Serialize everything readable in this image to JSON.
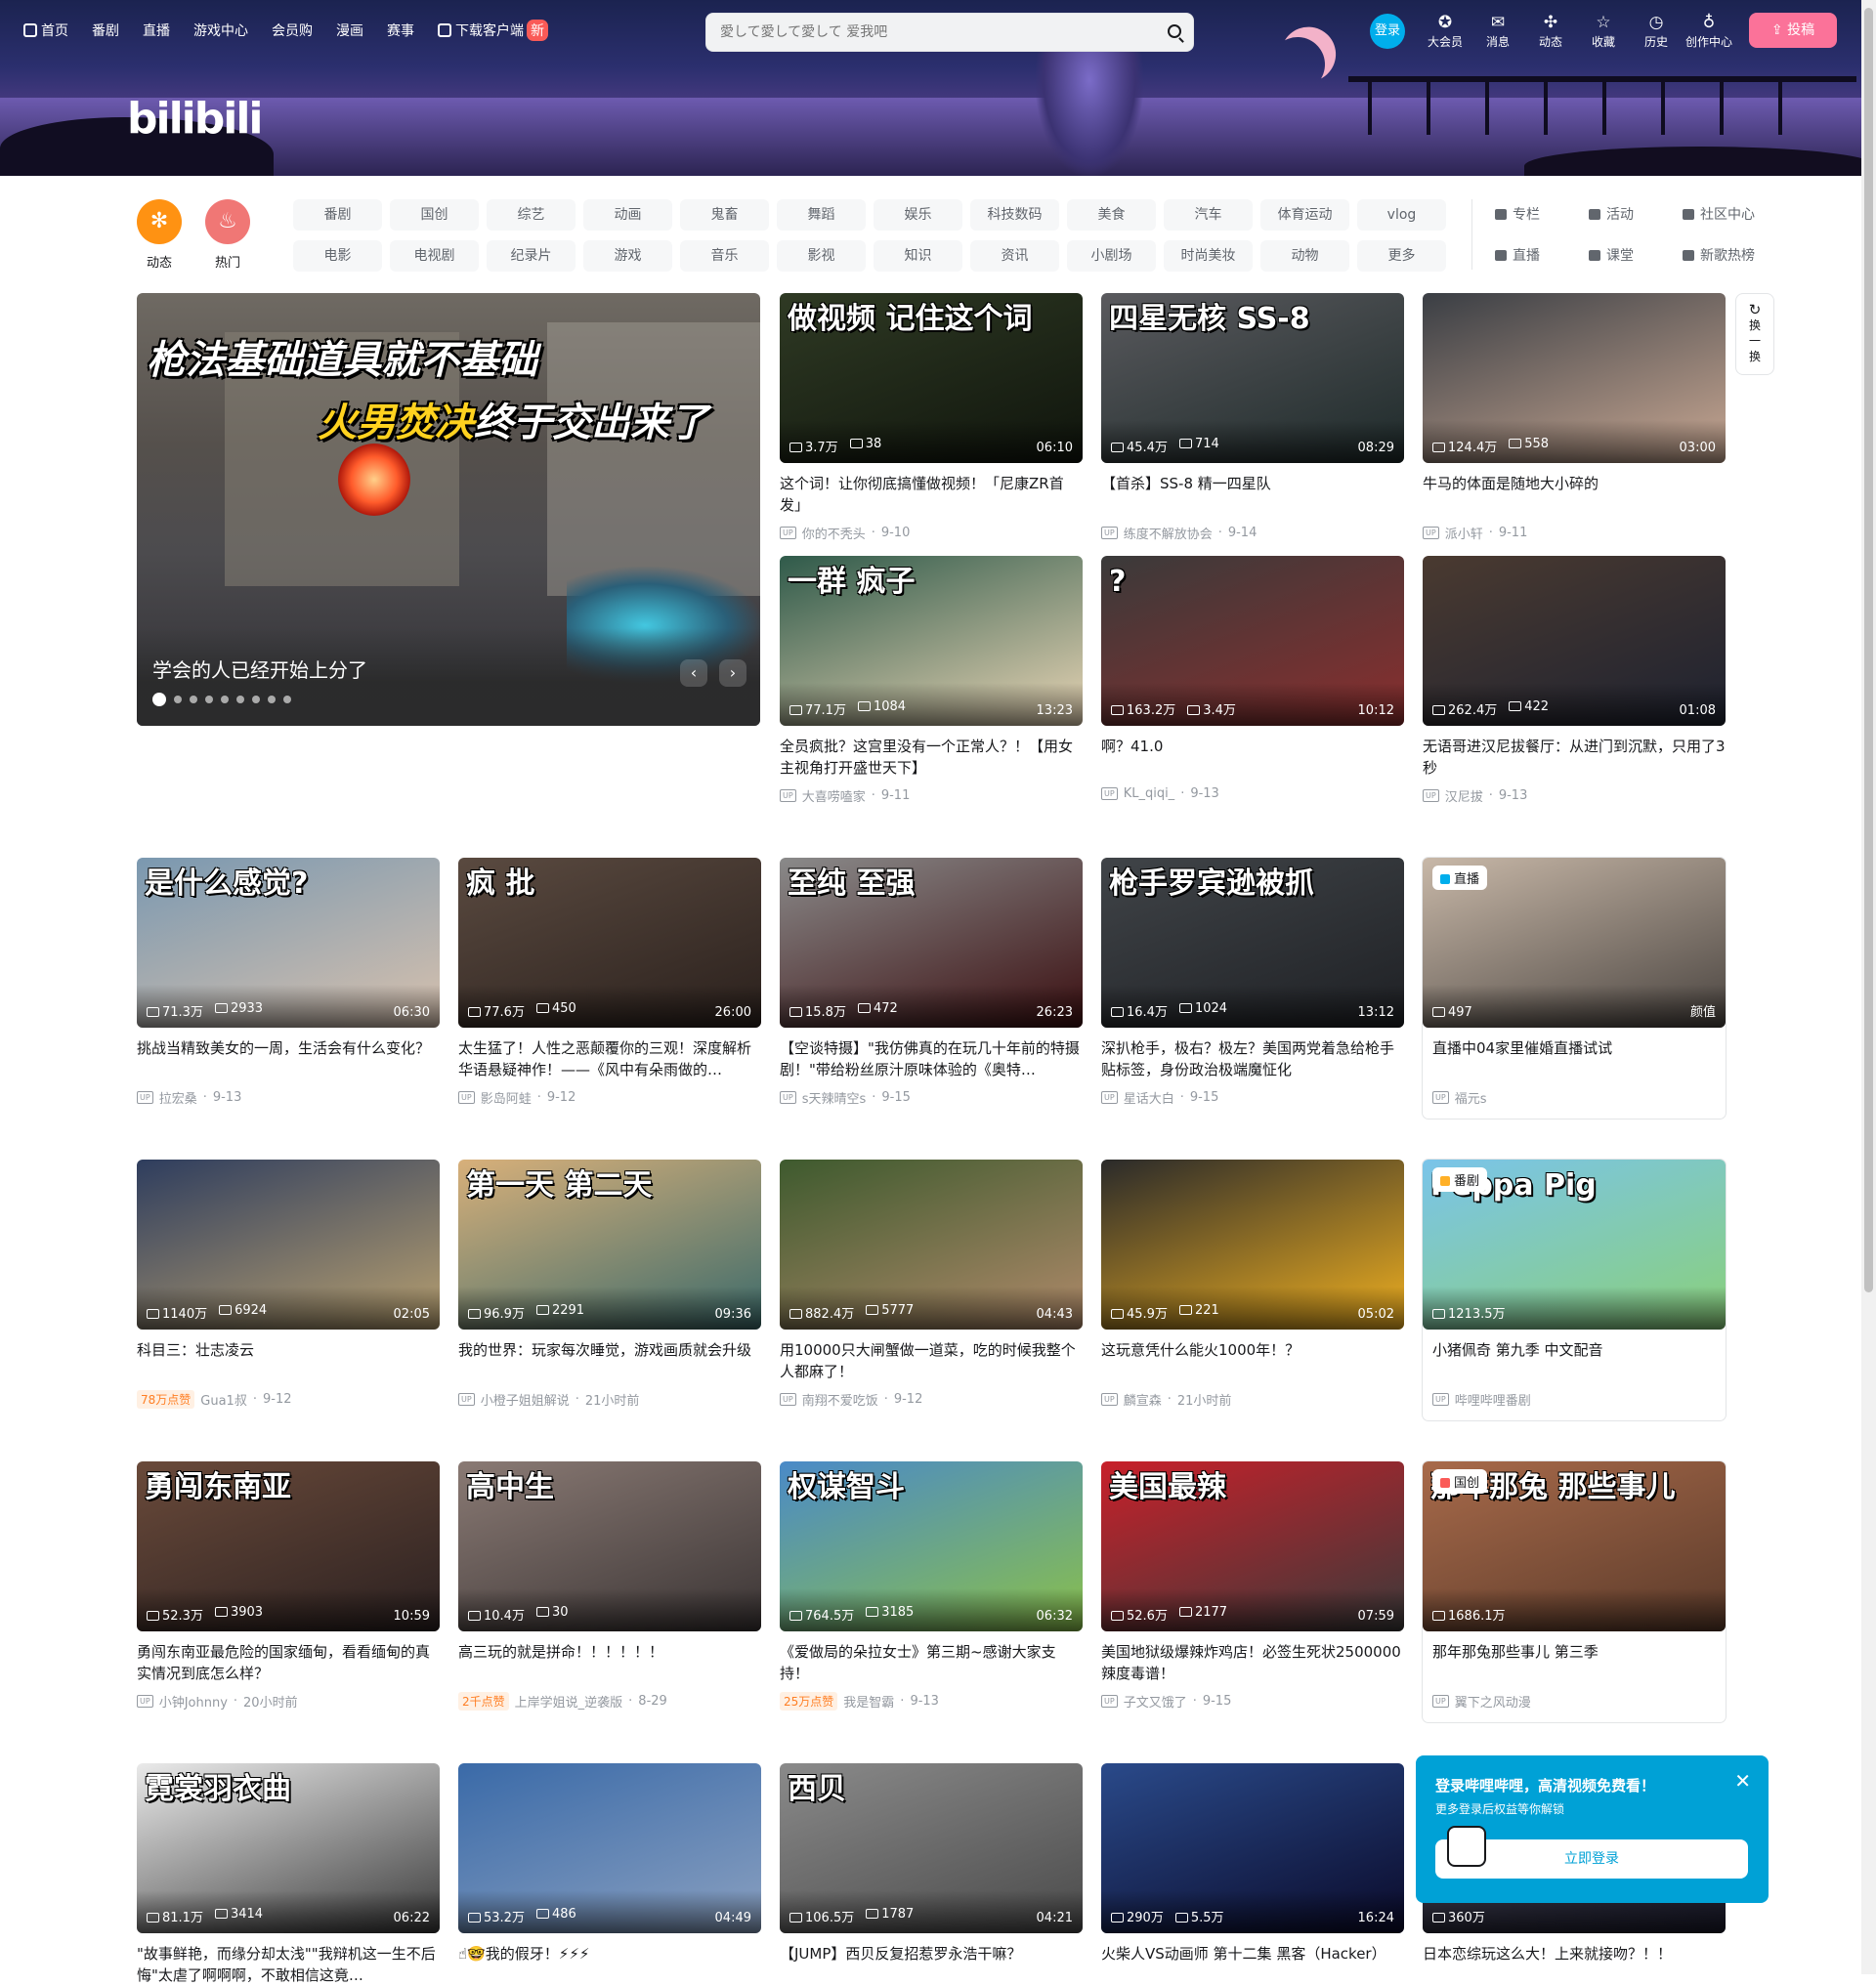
{
  "topnav": {
    "home": "首页",
    "bangumi": "番剧",
    "live": "直播",
    "game": "游戏中心",
    "mall": "会员购",
    "manga": "漫画",
    "match": "赛事",
    "download": "下载客户端",
    "new_badge": "新"
  },
  "search": {
    "placeholder": "愛して愛して愛して 爱我吧"
  },
  "header": {
    "login": "登录",
    "logo": "bilibili",
    "icons": [
      {
        "label": "大会员",
        "icon": "vip-icon"
      },
      {
        "label": "消息",
        "icon": "message-icon"
      },
      {
        "label": "动态",
        "icon": "dynamic-icon"
      },
      {
        "label": "收藏",
        "icon": "favorite-icon"
      },
      {
        "label": "历史",
        "icon": "history-icon"
      },
      {
        "label": "创作中心",
        "icon": "creator-icon"
      }
    ],
    "upload": "投稿"
  },
  "channels": {
    "dynamic": "动态",
    "hot": "热门",
    "grid": [
      "番剧",
      "国创",
      "综艺",
      "动画",
      "鬼畜",
      "舞蹈",
      "娱乐",
      "科技数码",
      "美食",
      "汽车",
      "体育运动",
      "vlog",
      "电影",
      "电视剧",
      "纪录片",
      "游戏",
      "音乐",
      "影视",
      "知识",
      "资讯",
      "小剧场",
      "时尚美妆",
      "动物",
      "更多"
    ],
    "extra": [
      "专栏",
      "活动",
      "社区中心",
      "直播",
      "课堂",
      "新歌热榜"
    ]
  },
  "carousel": {
    "headline1": "枪法基础道具就不基础",
    "headline2a": "火男",
    "headline2b": "焚决",
    "headline2c": "终于交出来了",
    "caption": "学会的人已经开始上分了",
    "prev": "‹",
    "next": "›"
  },
  "refresh": {
    "label": "换一换"
  },
  "videos": [
    {
      "title": "这个词！让你彻底搞懂做视频！「尼康ZR首发」",
      "views": "3.7万",
      "danmaku": "38",
      "duration": "06:10",
      "author": "你的不秃头",
      "date": "9-10",
      "art": "做视频 记住这个词",
      "bg": "linear-gradient(160deg,#2f3a24,#0f140c)"
    },
    {
      "title": "【首杀】SS-8 精一四星队",
      "views": "45.4万",
      "danmaku": "714",
      "duration": "08:29",
      "author": "练度不解放协会",
      "date": "9-14",
      "art": "四星无核 SS-8",
      "bg": "linear-gradient(160deg,#5a5a5e,#1e2a2a)"
    },
    {
      "title": "牛马的体面是随地大小碎的",
      "views": "124.4万",
      "danmaku": "558",
      "duration": "03:00",
      "author": "派小轩",
      "date": "9-11",
      "art": "",
      "bg": "linear-gradient(160deg,#3a3e44,#c9a893)"
    },
    {
      "title": "全员疯批？这宫里没有一个正常人？！【用女主视角打开盛世天下】",
      "views": "77.1万",
      "danmaku": "1084",
      "duration": "13:23",
      "author": "大喜唠嗑家",
      "date": "9-11",
      "art": "一群 疯子",
      "bg": "linear-gradient(160deg,#2f5a4a,#e8d5b5)"
    },
    {
      "title": "啊？41.0",
      "views": "163.2万",
      "danmaku": "3.4万",
      "duration": "10:12",
      "author": "KL_qiqi_",
      "date": "9-13",
      "art": "?",
      "bg": "linear-gradient(160deg,#3a3a3a,#8a2e2e)"
    },
    {
      "title": "无语哥进汉尼拔餐厅：从进门到沉默，只用了3秒",
      "views": "262.4万",
      "danmaku": "422",
      "duration": "01:08",
      "author": "汉尼拔",
      "date": "9-13",
      "art": "",
      "bg": "linear-gradient(160deg,#4a3a30,#1e2230)"
    },
    {
      "title": "挑战当精致美女的一周，生活会有什么变化？",
      "views": "71.3万",
      "danmaku": "2933",
      "duration": "06:30",
      "author": "拉宏桑",
      "date": "9-13",
      "art": "是什么感觉?",
      "bg": "linear-gradient(160deg,#7a98b0,#d7c1ae)"
    },
    {
      "title": "太生猛了！人性之恶颠覆你的三观！深度解析华语悬疑神作！——《风中有朵雨做的…",
      "views": "77.6万",
      "danmaku": "450",
      "duration": "26:00",
      "author": "影岛阿蛙",
      "date": "9-12",
      "art": "疯 批",
      "bg": "linear-gradient(160deg,#5a4a40,#2a201c)"
    },
    {
      "title": "【空谈特摄】\"我仿佛真的在玩几十年前的特摄剧！\"带给粉丝原汁原味体验的《奥特…",
      "views": "15.8万",
      "danmaku": "472",
      "duration": "26:23",
      "author": "s天辣晴空s",
      "date": "9-15",
      "art": "至纯 至强",
      "bg": "linear-gradient(160deg,#8a8a8a,#3a0e10)"
    },
    {
      "title": "深扒枪手，极右？极左？美国两党着急给枪手贴标签，身份政治极端魔怔化",
      "views": "16.4万",
      "danmaku": "1024",
      "duration": "13:12",
      "author": "星话大白",
      "date": "9-15",
      "art": "枪手罗宾逊被抓",
      "bg": "linear-gradient(160deg,#404448,#1e2024)"
    },
    {
      "title": "04家里催婚直播试试",
      "views": "497",
      "danmaku": "",
      "duration": "颜值",
      "author": "福元s",
      "date": "",
      "art": "",
      "bg": "linear-gradient(160deg,#c8b8a8,#4a4440)",
      "tag": "直播",
      "live": "直播中"
    },
    {
      "title": "科目三：壮志凌云",
      "views": "1140万",
      "danmaku": "6924",
      "duration": "02:05",
      "author": "Gua1叔",
      "date": "9-12",
      "art": "",
      "bg": "linear-gradient(160deg,#2e3d5e,#b8a070)",
      "likes": "78万点赞"
    },
    {
      "title": "我的世界：玩家每次睡觉，游戏画质就会升级",
      "views": "96.9万",
      "danmaku": "2291",
      "duration": "09:36",
      "author": "小橙子姐姐解说",
      "date": "21小时前",
      "art": "第一天 第二天",
      "bg": "linear-gradient(160deg,#d8b07a,#3b6a6a)"
    },
    {
      "title": "用10000只大闸蟹做一道菜，吃的时候我整个人都麻了！",
      "views": "882.4万",
      "danmaku": "5777",
      "duration": "04:43",
      "author": "南翔不爱吃饭",
      "date": "9-12",
      "art": "",
      "bg": "linear-gradient(160deg,#3e5a2e,#b08a6a)"
    },
    {
      "title": "这玩意凭什么能火1000年！？",
      "views": "45.9万",
      "danmaku": "221",
      "duration": "05:02",
      "author": "麟宣森",
      "date": "21小时前",
      "art": "",
      "bg": "linear-gradient(160deg,#2a2a2a,#f0b020)"
    },
    {
      "title": "小猪佩奇 第九季 中文配音",
      "views": "1213.5万",
      "danmaku": "",
      "duration": "",
      "author": "哔哩哔哩番剧",
      "date": "",
      "art": "Peppa Pig",
      "bg": "linear-gradient(160deg,#7ac4ea,#8ad07a)",
      "tag": "番剧"
    },
    {
      "title": "勇闯东南亚最危险的国家缅甸，看看缅甸的真实情况到底怎么样？",
      "views": "52.3万",
      "danmaku": "3903",
      "duration": "10:59",
      "author": "小钟Johnny",
      "date": "20小时前",
      "art": "勇闯东南亚",
      "bg": "linear-gradient(160deg,#6a4a3a,#2a2020)"
    },
    {
      "title": "高三玩的就是拼命！！！！！！",
      "views": "10.4万",
      "danmaku": "30",
      "duration": "",
      "author": "上岸学姐说_逆袭版",
      "date": "8-29",
      "art": "高中生",
      "bg": "linear-gradient(160deg,#8a7a74,#3a3434)",
      "likes": "2千点赞"
    },
    {
      "title": "《爱做局的朵拉女士》第三期~感谢大家支持！",
      "views": "764.5万",
      "danmaku": "3185",
      "duration": "06:32",
      "author": "我是智霸",
      "date": "9-13",
      "art": "权谋智斗",
      "bg": "linear-gradient(160deg,#4a8ac8,#8ac04a)",
      "likes": "25万点赞"
    },
    {
      "title": "美国地狱级爆辣炸鸡店！必签生死状2500000辣度毒谱！",
      "views": "52.6万",
      "danmaku": "2177",
      "duration": "07:59",
      "author": "子文又饿了",
      "date": "9-15",
      "art": "美国最辣",
      "bg": "linear-gradient(160deg,#c8202a,#3a3a3a)"
    },
    {
      "title": "那年那兔那些事儿 第三季",
      "views": "1686.1万",
      "danmaku": "",
      "duration": "",
      "author": "翼下之风动漫",
      "date": "",
      "art": "那年那兔 那些事儿",
      "bg": "linear-gradient(160deg,#a86a4a,#5a3a2a)",
      "tag": "国创"
    },
    {
      "title": "\"故事鲜艳，而缘分却太浅\"\"我辩机这一生不后悔\"太虐了啊啊啊，不敢相信这竟…",
      "views": "81.1万",
      "danmaku": "3414",
      "duration": "06:22",
      "author": "",
      "date": "",
      "art": "霓裳羽衣曲",
      "bg": "linear-gradient(160deg,#eaeaea,#3a3a3a)"
    },
    {
      "title": "☝🤓我的假牙！⚡⚡⚡",
      "views": "53.2万",
      "danmaku": "486",
      "duration": "04:49",
      "author": "",
      "date": "",
      "art": "",
      "bg": "linear-gradient(160deg,#3a6aa8,#8aa0c0)"
    },
    {
      "title": "【JUMP】西贝反复招惹罗永浩干嘛？",
      "views": "106.5万",
      "danmaku": "1787",
      "duration": "04:21",
      "author": "",
      "date": "",
      "art": "西贝",
      "bg": "linear-gradient(160deg,#8a8a8a,#4a4a4a)"
    },
    {
      "title": "火柴人VS动画师 第十二集 黑客（Hacker）",
      "views": "290万",
      "danmaku": "5.5万",
      "duration": "16:24",
      "author": "",
      "date": "",
      "art": "",
      "bg": "linear-gradient(160deg,#2a4a8a,#0a0a2a)"
    },
    {
      "title": "日本恋综玩这么大！上来就接吻？！！",
      "views": "360万",
      "danmaku": "",
      "duration": "",
      "author": "",
      "date": "",
      "art": "",
      "bg": "linear-gradient(160deg,#4a4a5a,#1a1a2a)"
    }
  ],
  "popup": {
    "title": "登录哔哩哔哩，高清视频免费看！",
    "subtitle": "更多登录后权益等你解锁",
    "button": "立即登录",
    "close": "✕"
  }
}
